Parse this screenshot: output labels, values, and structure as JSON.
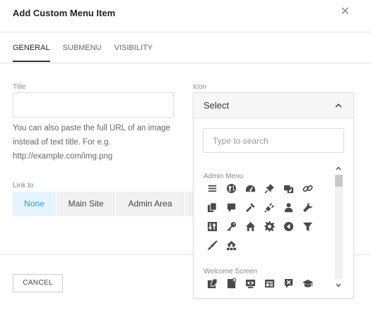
{
  "dialog": {
    "title": "Add Custom Menu Item"
  },
  "tabs": [
    {
      "label": "GENERAL",
      "active": true
    },
    {
      "label": "SUBMENU",
      "active": false
    },
    {
      "label": "VISIBILITY",
      "active": false
    }
  ],
  "form": {
    "title_label": "Title",
    "title_value": "",
    "help_text": "You can also paste the full URL of an image instead of text title. For e.g. http://example.com/img.png",
    "link_label": "Link to",
    "link_options": [
      "None",
      "Main Site",
      "Admin Area"
    ],
    "link_selected": "None",
    "icon_label": "Icon"
  },
  "icon_picker": {
    "selected": "Select",
    "search_placeholder": "Type to search",
    "groups": [
      {
        "name": "Admin Menu",
        "icons": [
          "menu-icon",
          "globe-icon",
          "dashboard-icon",
          "pin-icon",
          "media-icon",
          "link-icon",
          "copy-icon",
          "comment-icon",
          "appearance-brush-icon",
          "plugin-icon",
          "user-icon",
          "wrench-icon",
          "settings-sliders-icon",
          "key-icon",
          "home-icon",
          "gear-icon",
          "collapse-icon",
          "filter-icon",
          "paintbrush-icon",
          "network-home-icon"
        ]
      },
      {
        "name": "Welcome Screen",
        "icons": [
          "write-post-icon",
          "add-page-icon",
          "view-site-icon",
          "widgets-icon",
          "comments-off-icon",
          "learn-more-icon"
        ]
      }
    ]
  },
  "footer": {
    "cancel_label": "CANCEL"
  },
  "colors": {
    "accent": "#2b9be0",
    "active_bg": "#e5f4fd",
    "icon": "#4a4a4a"
  }
}
